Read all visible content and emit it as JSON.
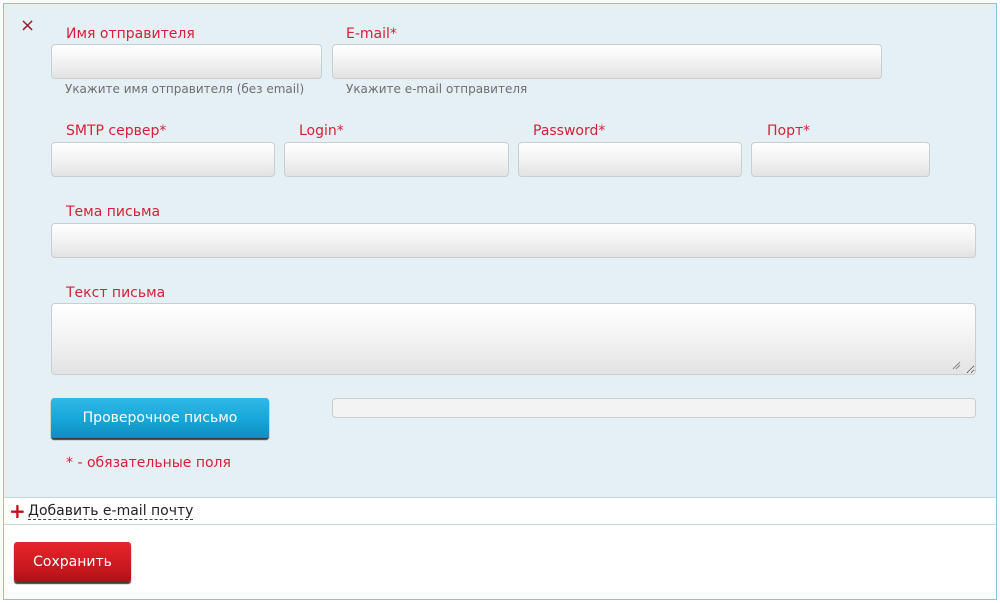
{
  "form": {
    "close_icon": "×",
    "sender_name": {
      "label": "Имя отправителя",
      "value": "",
      "hint": "Укажите имя отправителя (без email)"
    },
    "email": {
      "label": "E-mail*",
      "value": "",
      "hint": "Укажите e-mail отправителя"
    },
    "smtp_server": {
      "label": "SMTP сервер*",
      "value": ""
    },
    "login": {
      "label": "Login*",
      "value": ""
    },
    "password": {
      "label": "Password*",
      "value": ""
    },
    "port": {
      "label": "Порт*",
      "value": ""
    },
    "subject": {
      "label": "Тема письма",
      "value": ""
    },
    "body": {
      "label": "Текст письма",
      "value": ""
    },
    "test_button_label": "Проверочное письмо",
    "required_note": "* - обязательные поля"
  },
  "add_email": {
    "icon": "+",
    "label": "Добавить e-mail почту"
  },
  "save_button_label": "Сохранить",
  "colors": {
    "label": "#d4203a",
    "panel_bg": "#e5f0f4",
    "test_button": "#17a6d8",
    "save_button": "#cf1a21"
  }
}
